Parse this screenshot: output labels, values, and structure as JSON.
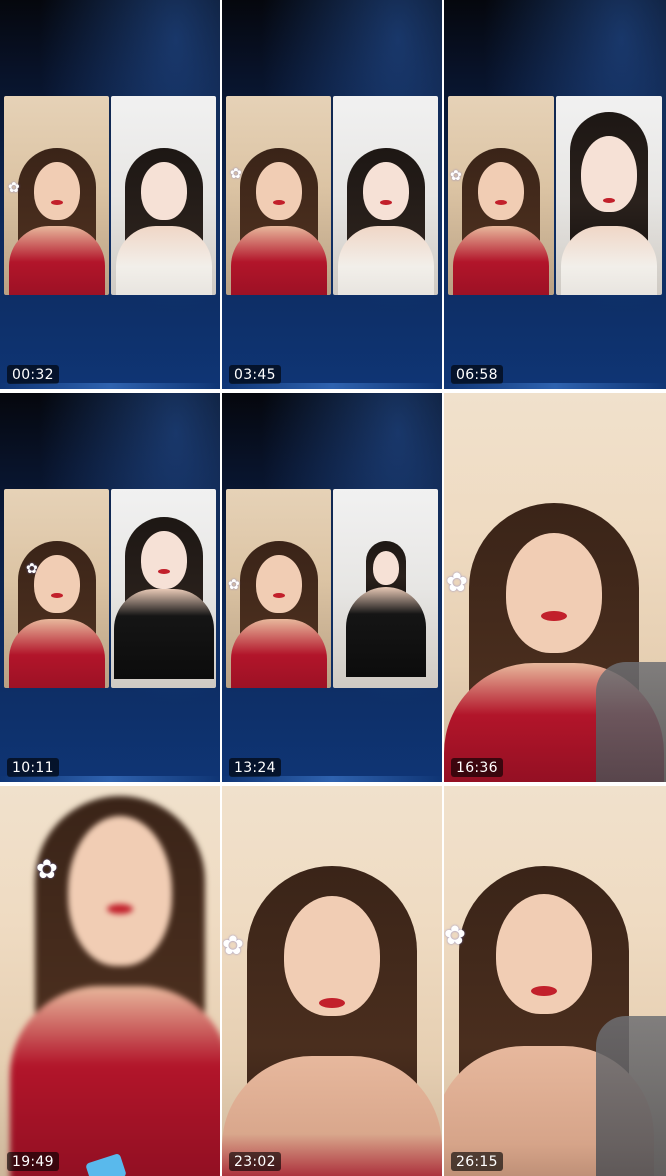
{
  "thumbnails": [
    {
      "timestamp": "00:32",
      "layout": "split-call"
    },
    {
      "timestamp": "03:45",
      "layout": "split-call"
    },
    {
      "timestamp": "06:58",
      "layout": "split-call"
    },
    {
      "timestamp": "10:11",
      "layout": "split-call"
    },
    {
      "timestamp": "13:24",
      "layout": "split-call"
    },
    {
      "timestamp": "16:36",
      "layout": "full-frame"
    },
    {
      "timestamp": "19:49",
      "layout": "full-frame"
    },
    {
      "timestamp": "23:02",
      "layout": "full-frame"
    },
    {
      "timestamp": "26:15",
      "layout": "full-frame"
    }
  ],
  "colors": {
    "call_background": "#0f3575",
    "timestamp_background": "#000000",
    "timestamp_text": "#ffffff"
  },
  "icons": {
    "hair_accessory": "white-flower-icon"
  }
}
